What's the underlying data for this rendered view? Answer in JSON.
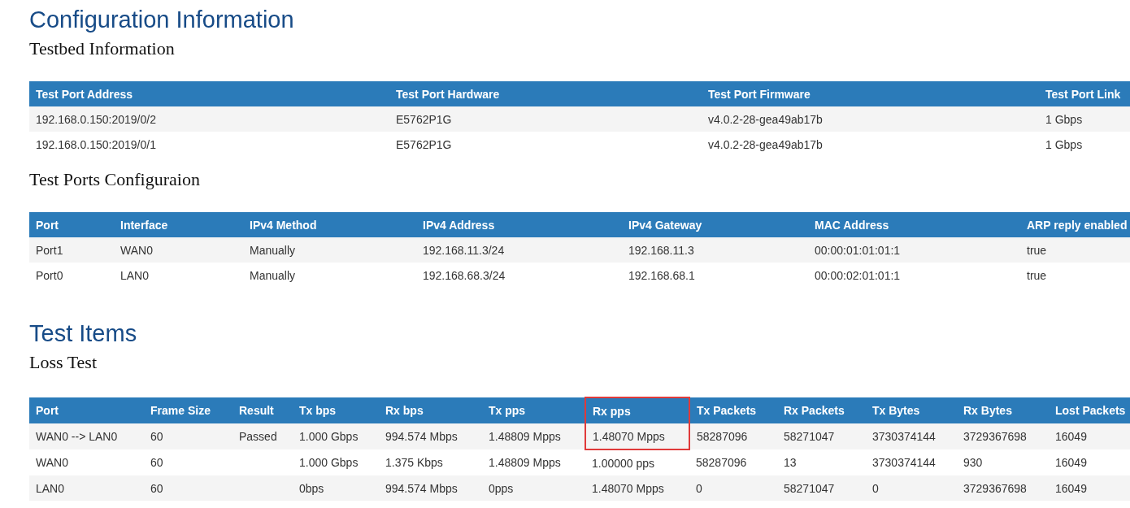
{
  "sections": [
    {
      "title": "Configuration Information",
      "subsections": [
        {
          "title": "Testbed Information",
          "table": {
            "columns": [
              {
                "label": "Test Port Address"
              },
              {
                "label": "Test Port Hardware"
              },
              {
                "label": "Test Port Firmware"
              },
              {
                "label": "Test Port Link"
              }
            ],
            "rows": [
              {
                "cells": [
                  "192.168.0.150:2019/0/2",
                  "E5762P1G",
                  "v4.0.2-28-gea49ab17b",
                  "1 Gbps"
                ]
              },
              {
                "cells": [
                  "192.168.0.150:2019/0/1",
                  "E5762P1G",
                  "v4.0.2-28-gea49ab17b",
                  "1 Gbps"
                ]
              }
            ]
          }
        },
        {
          "title": "Test Ports Configuraion",
          "table": {
            "columns": [
              {
                "label": "Port"
              },
              {
                "label": "Interface"
              },
              {
                "label": "IPv4 Method"
              },
              {
                "label": "IPv4 Address"
              },
              {
                "label": "IPv4 Gateway"
              },
              {
                "label": "MAC Address"
              },
              {
                "label": "ARP reply enabled"
              }
            ],
            "rows": [
              {
                "cells": [
                  "Port1",
                  "WAN0",
                  "Manually",
                  "192.168.11.3/24",
                  "192.168.11.3",
                  "00:00:01:01:01:1",
                  "true"
                ]
              },
              {
                "cells": [
                  "Port0",
                  "LAN0",
                  "Manually",
                  "192.168.68.3/24",
                  "192.168.68.1",
                  "00:00:02:01:01:1",
                  "true"
                ]
              }
            ]
          }
        }
      ]
    },
    {
      "title": "Test Items",
      "subsections": [
        {
          "title": "Loss Test",
          "table": {
            "columns": [
              {
                "label": "Port",
                "highlighted": false
              },
              {
                "label": "Frame Size",
                "highlighted": false
              },
              {
                "label": "Result",
                "highlighted": false
              },
              {
                "label": "Tx bps",
                "highlighted": false
              },
              {
                "label": "Rx bps",
                "highlighted": false
              },
              {
                "label": "Tx pps",
                "highlighted": false
              },
              {
                "label": "Rx pps",
                "highlighted": true
              },
              {
                "label": "Tx Packets",
                "highlighted": false
              },
              {
                "label": "Rx Packets",
                "highlighted": false
              },
              {
                "label": "Tx Bytes",
                "highlighted": false
              },
              {
                "label": "Rx Bytes",
                "highlighted": false
              },
              {
                "label": "Lost Packets",
                "highlighted": false
              }
            ],
            "rows": [
              {
                "highlighted": true,
                "cells": [
                  "WAN0 --> LAN0",
                  "60",
                  "Passed",
                  "1.000 Gbps",
                  "994.574 Mbps",
                  "1.48809 Mpps",
                  "1.48070 Mpps",
                  "58287096",
                  "58271047",
                  "3730374144",
                  "3729367698",
                  "16049"
                ]
              },
              {
                "highlighted": false,
                "cells": [
                  "WAN0",
                  "60",
                  null,
                  "1.000 Gbps",
                  "1.375 Kbps",
                  "1.48809 Mpps",
                  "1.00000 pps",
                  "58287096",
                  "13",
                  "3730374144",
                  "930",
                  "16049"
                ]
              },
              {
                "highlighted": false,
                "cells": [
                  "LAN0",
                  "60",
                  null,
                  "0bps",
                  "994.574 Mbps",
                  "0pps",
                  "1.48070 Mpps",
                  "0",
                  "58271047",
                  "0",
                  "3729367698",
                  "16049"
                ]
              }
            ]
          }
        }
      ]
    }
  ]
}
